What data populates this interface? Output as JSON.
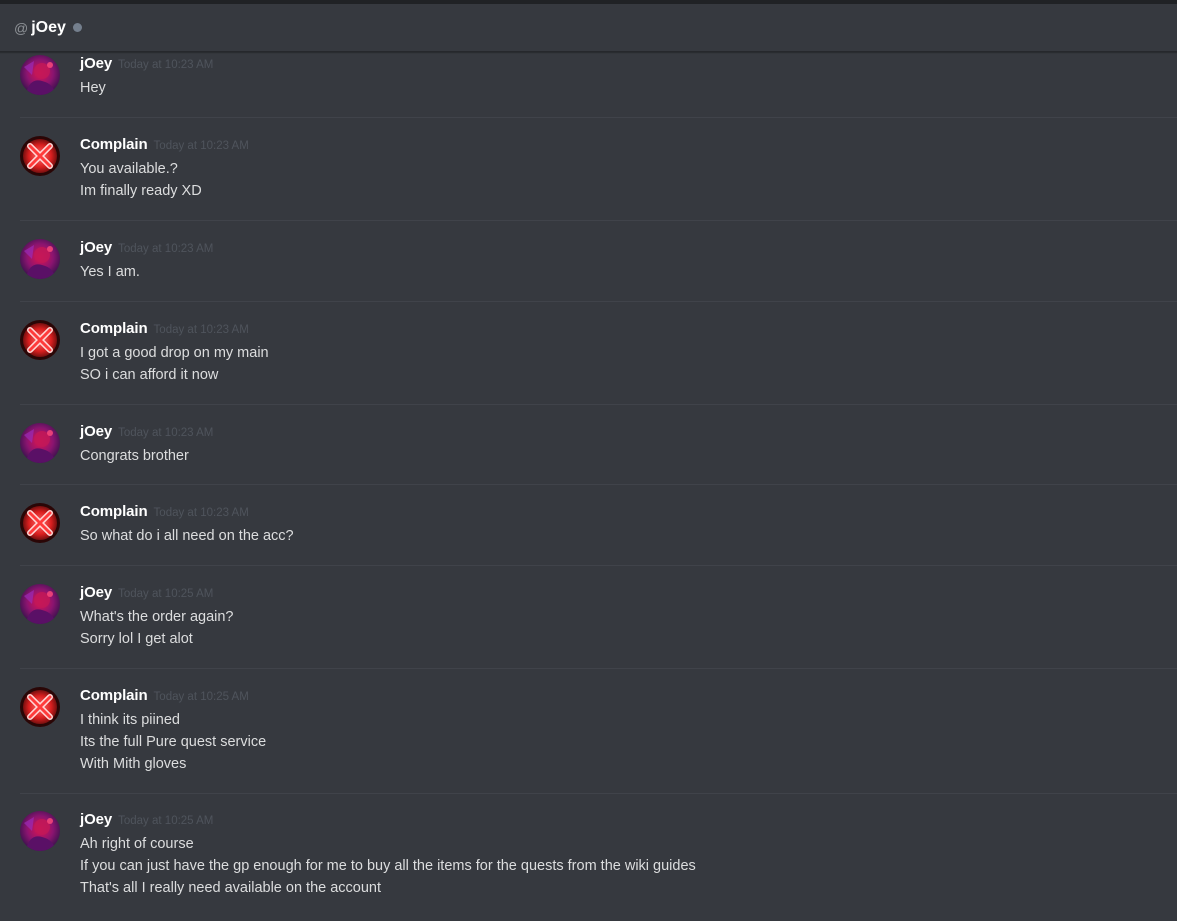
{
  "header": {
    "at_symbol": "@",
    "channel_name": "jOey",
    "status_color": "#747f8d"
  },
  "colors": {
    "background": "#36393f",
    "author_name": "#ffffff",
    "message_text": "#dcddde",
    "timestamp": "#4f545c"
  },
  "messages": [
    {
      "author": "jOey",
      "avatar": "joey-avatar-icon",
      "timestamp": "Today at 10:23 AM",
      "lines": [
        "Hey"
      ]
    },
    {
      "author": "Complain",
      "avatar": "complain-avatar-icon",
      "timestamp": "Today at 10:23 AM",
      "lines": [
        "You available.?",
        "Im finally ready XD"
      ]
    },
    {
      "author": "jOey",
      "avatar": "joey-avatar-icon",
      "timestamp": "Today at 10:23 AM",
      "lines": [
        "Yes I am."
      ]
    },
    {
      "author": "Complain",
      "avatar": "complain-avatar-icon",
      "timestamp": "Today at 10:23 AM",
      "lines": [
        "I got a good drop on my main",
        "SO i can afford it now"
      ]
    },
    {
      "author": "jOey",
      "avatar": "joey-avatar-icon",
      "timestamp": "Today at 10:23 AM",
      "lines": [
        "Congrats brother"
      ]
    },
    {
      "author": "Complain",
      "avatar": "complain-avatar-icon",
      "timestamp": "Today at 10:23 AM",
      "lines": [
        "So what do i all need on the acc?"
      ]
    },
    {
      "author": "jOey",
      "avatar": "joey-avatar-icon",
      "timestamp": "Today at 10:25 AM",
      "lines": [
        "What's the order again?",
        "Sorry lol I get alot"
      ]
    },
    {
      "author": "Complain",
      "avatar": "complain-avatar-icon",
      "timestamp": "Today at 10:25 AM",
      "lines": [
        "I think its piined",
        "Its the full Pure quest service",
        "With Mith gloves"
      ]
    },
    {
      "author": "jOey",
      "avatar": "joey-avatar-icon",
      "timestamp": "Today at 10:25 AM",
      "lines": [
        "Ah right of course",
        "If you can just have the gp enough for me to buy all the items for the quests from the wiki guides",
        "That's all I really need available on the account"
      ]
    }
  ]
}
